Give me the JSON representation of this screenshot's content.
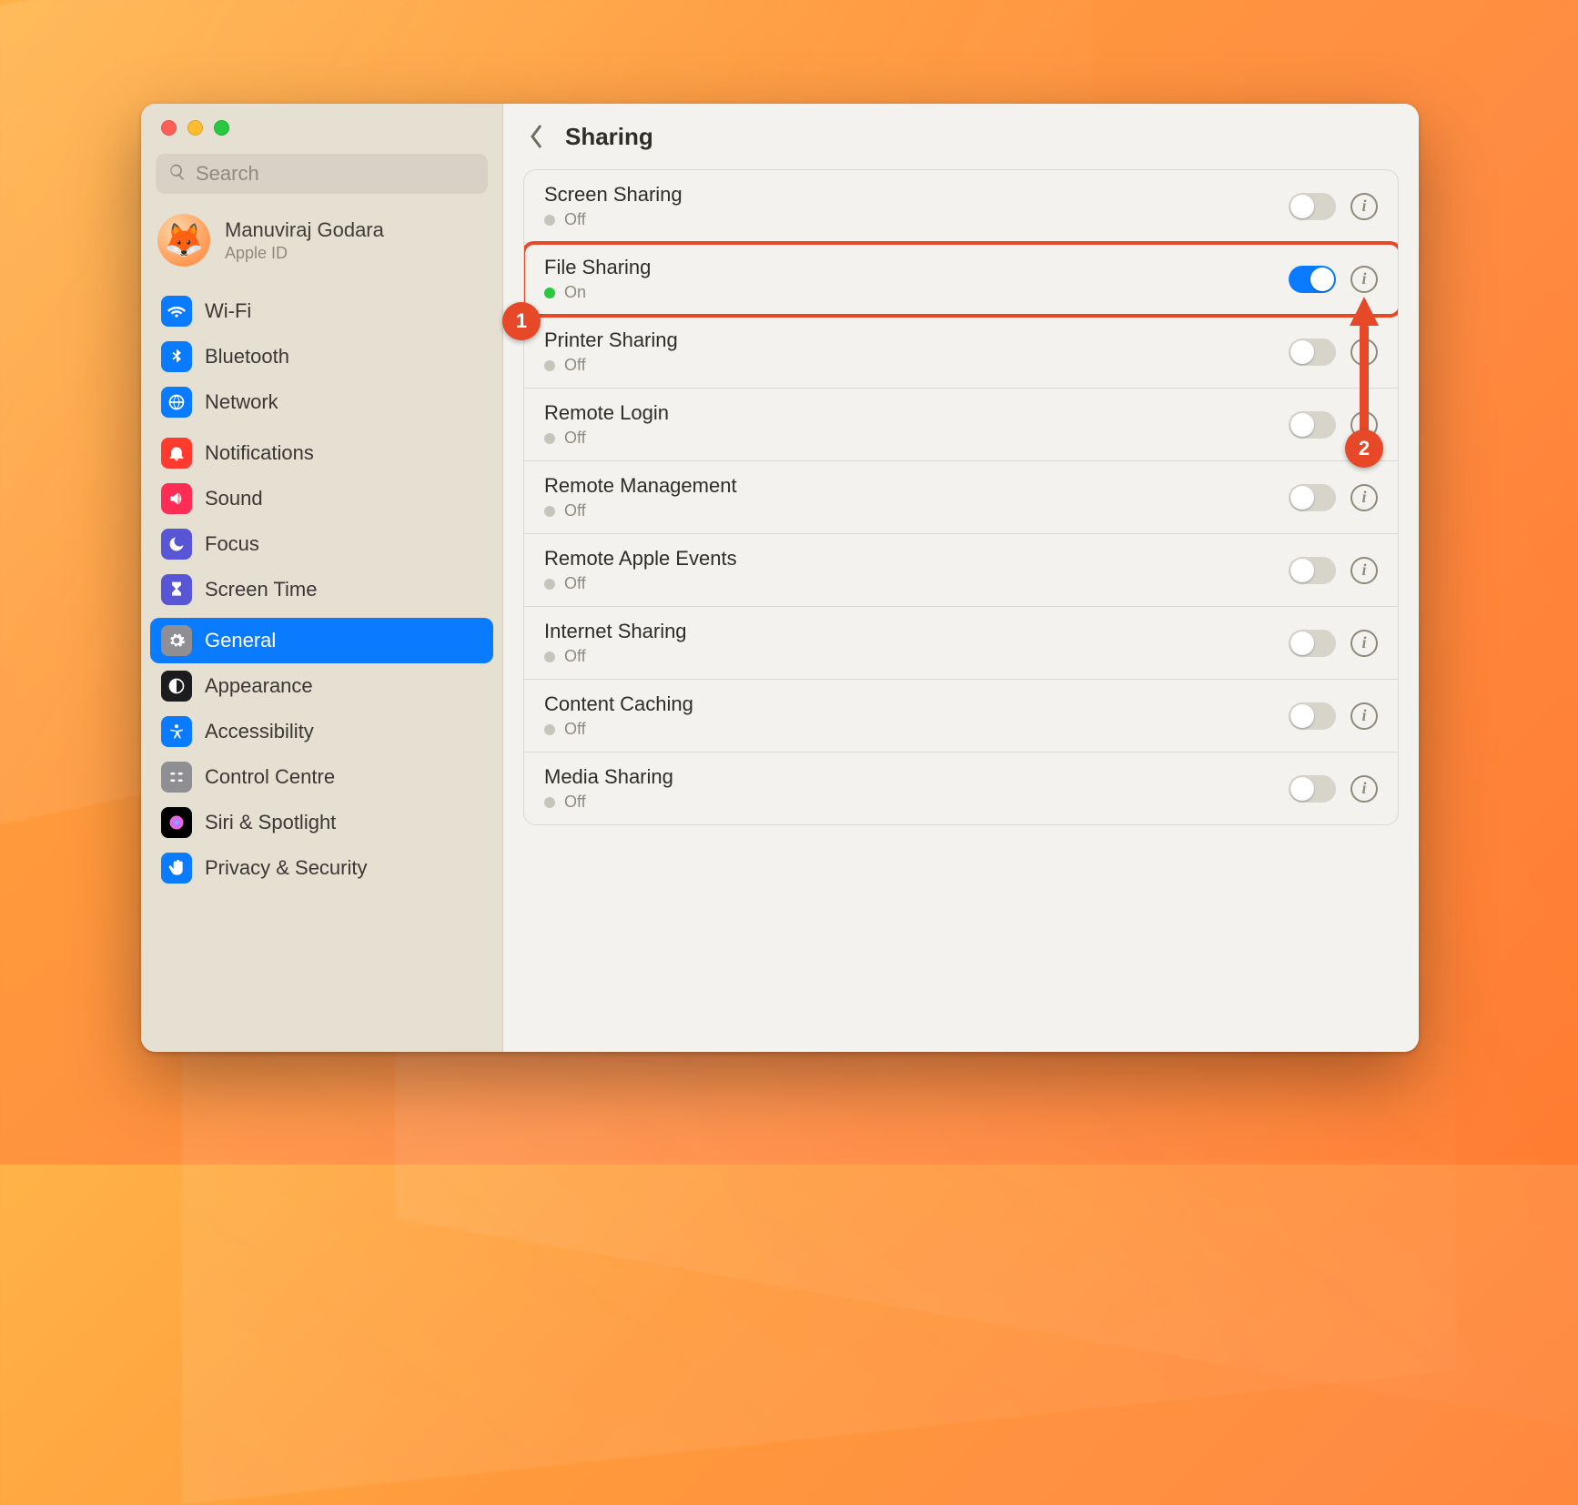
{
  "search": {
    "placeholder": "Search"
  },
  "account": {
    "name": "Manuviraj Godara",
    "subtitle": "Apple ID",
    "avatar_emoji": "🦊"
  },
  "title": "Sharing",
  "sidebar": {
    "items": [
      {
        "label": "Wi-Fi",
        "color": "#0a7bff",
        "icon": "wifi"
      },
      {
        "label": "Bluetooth",
        "color": "#0a7bff",
        "icon": "bluetooth"
      },
      {
        "label": "Network",
        "color": "#0a7bff",
        "icon": "globe"
      },
      {
        "label": "Notifications",
        "color": "#ff3b30",
        "icon": "bell"
      },
      {
        "label": "Sound",
        "color": "#ff2d55",
        "icon": "speaker"
      },
      {
        "label": "Focus",
        "color": "#5856d6",
        "icon": "moon"
      },
      {
        "label": "Screen Time",
        "color": "#5856d6",
        "icon": "hourglass"
      },
      {
        "label": "General",
        "color": "#8e8e93",
        "icon": "gear",
        "selected": true
      },
      {
        "label": "Appearance",
        "color": "#1c1c1e",
        "icon": "appearance"
      },
      {
        "label": "Accessibility",
        "color": "#0a7bff",
        "icon": "accessibility"
      },
      {
        "label": "Control Centre",
        "color": "#8e8e93",
        "icon": "control"
      },
      {
        "label": "Siri & Spotlight",
        "color": "#000000",
        "icon": "siri"
      },
      {
        "label": "Privacy & Security",
        "color": "#0a7bff",
        "icon": "hand"
      }
    ]
  },
  "rows": [
    {
      "name": "Screen Sharing",
      "status": "Off",
      "on": false
    },
    {
      "name": "File Sharing",
      "status": "On",
      "on": true,
      "highlighted": true
    },
    {
      "name": "Printer Sharing",
      "status": "Off",
      "on": false
    },
    {
      "name": "Remote Login",
      "status": "Off",
      "on": false
    },
    {
      "name": "Remote Management",
      "status": "Off",
      "on": false
    },
    {
      "name": "Remote Apple Events",
      "status": "Off",
      "on": false
    },
    {
      "name": "Internet Sharing",
      "status": "Off",
      "on": false
    },
    {
      "name": "Content Caching",
      "status": "Off",
      "on": false
    },
    {
      "name": "Media Sharing",
      "status": "Off",
      "on": false
    }
  ],
  "annotations": {
    "one": "1",
    "two": "2"
  },
  "colors": {
    "highlight": "#e64828",
    "accent": "#0a7bff",
    "on_dot": "#29c840"
  }
}
